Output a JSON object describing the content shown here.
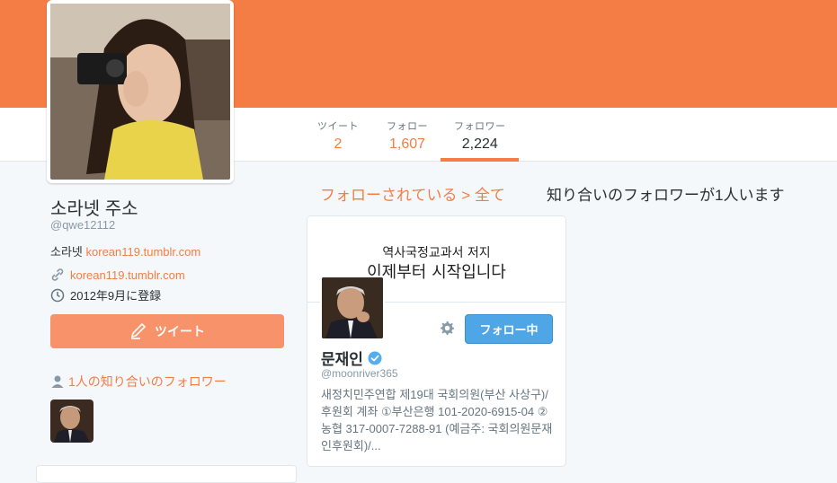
{
  "profile": {
    "name": "소라넷 주소",
    "handle": "@qwe12112",
    "bio_prefix": "소라넷",
    "bio_link": "korean119.tumblr.com",
    "website": "korean119.tumblr.com",
    "joined": "2012年9月に登録",
    "tweet_button": "ツイート"
  },
  "stats": [
    {
      "label": "ツイート",
      "value": "2"
    },
    {
      "label": "フォロー",
      "value": "1,607"
    },
    {
      "label": "フォロワー",
      "value": "2,224"
    }
  ],
  "known_followers": {
    "label": "1人の知り合いのフォロワー"
  },
  "main": {
    "breadcrumb": "フォローされている > 全て",
    "info": "知り合いのフォロワーが1人います"
  },
  "card": {
    "banner_line1": "역사국정교과서 저지",
    "banner_line2": "이제부터 시작입니다",
    "name": "문재인",
    "handle": "@moonriver365",
    "bio": "새정치민주연합 제19대 국회의원(부산 사상구)/ 후원회 계좌 ①부산은행 101-2020-6915-04 ②농협 317-0007-7288-91 (예금주: 국회의원문재인후원회)/...",
    "follow_button": "フォロー中"
  },
  "colors": {
    "accent": "#f47d45",
    "follow_blue": "#4ea6e6"
  }
}
